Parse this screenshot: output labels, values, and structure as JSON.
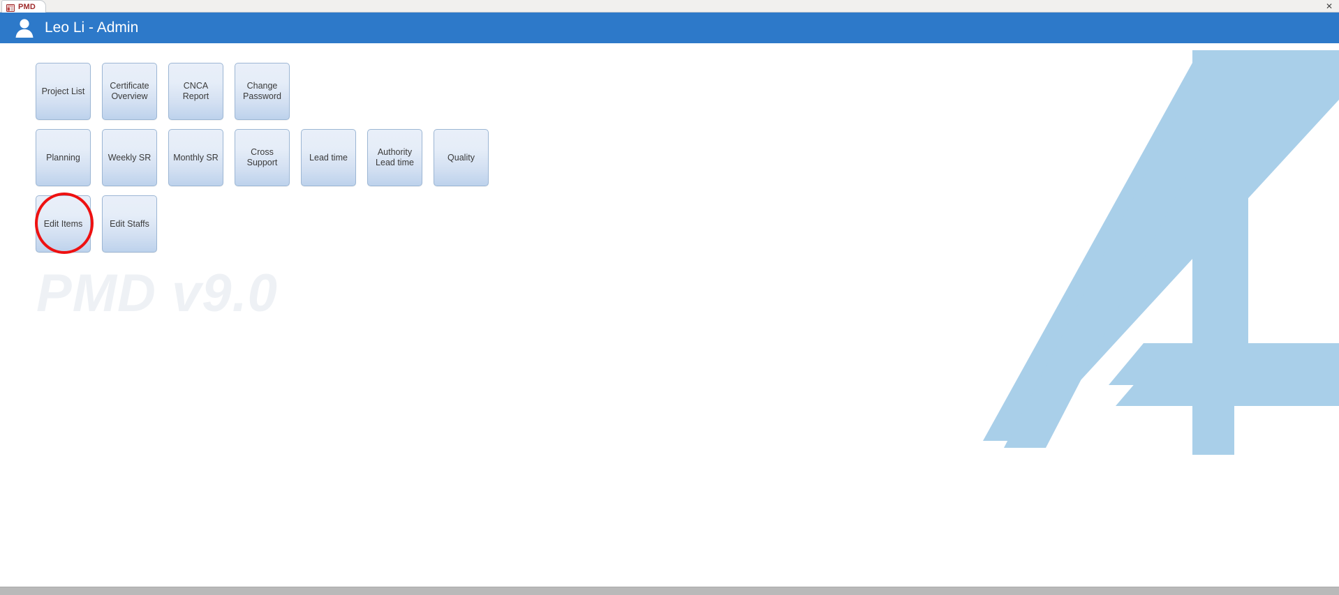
{
  "window": {
    "tab": {
      "label": "PMD",
      "icon": "form-view-icon",
      "close_label": "✕"
    }
  },
  "header": {
    "avatar_icon": "user-avatar-icon",
    "title": "Leo Li - Admin",
    "background_color": "#2d79c9"
  },
  "main": {
    "watermark": "PMD v9.0",
    "logo_icon": "pmd-triangle-logo",
    "logo_color": "#a9cfe9",
    "rows": [
      {
        "buttons": [
          {
            "label": "Project List",
            "name": "project-list"
          },
          {
            "label": "Certificate\nOverview",
            "name": "certificate-overview"
          },
          {
            "label": "CNCA Report",
            "name": "cnca-report"
          },
          {
            "label": "Change\nPassword",
            "name": "change-password"
          }
        ]
      },
      {
        "buttons": [
          {
            "label": "Planning",
            "name": "planning"
          },
          {
            "label": "Weekly SR",
            "name": "weekly-sr"
          },
          {
            "label": "Monthly SR",
            "name": "monthly-sr"
          },
          {
            "label": "Cross Support",
            "name": "cross-support"
          },
          {
            "label": "Lead time",
            "name": "lead-time"
          },
          {
            "label": "Authority\nLead time",
            "name": "authority-lead-time"
          },
          {
            "label": "Quality",
            "name": "quality"
          }
        ]
      },
      {
        "buttons": [
          {
            "label": "Edit Items",
            "name": "edit-items"
          },
          {
            "label": "Edit Staffs",
            "name": "edit-staffs"
          }
        ]
      }
    ],
    "annotation": {
      "shape": "ellipse",
      "color": "#ee1111",
      "target": "Edit Items"
    }
  }
}
